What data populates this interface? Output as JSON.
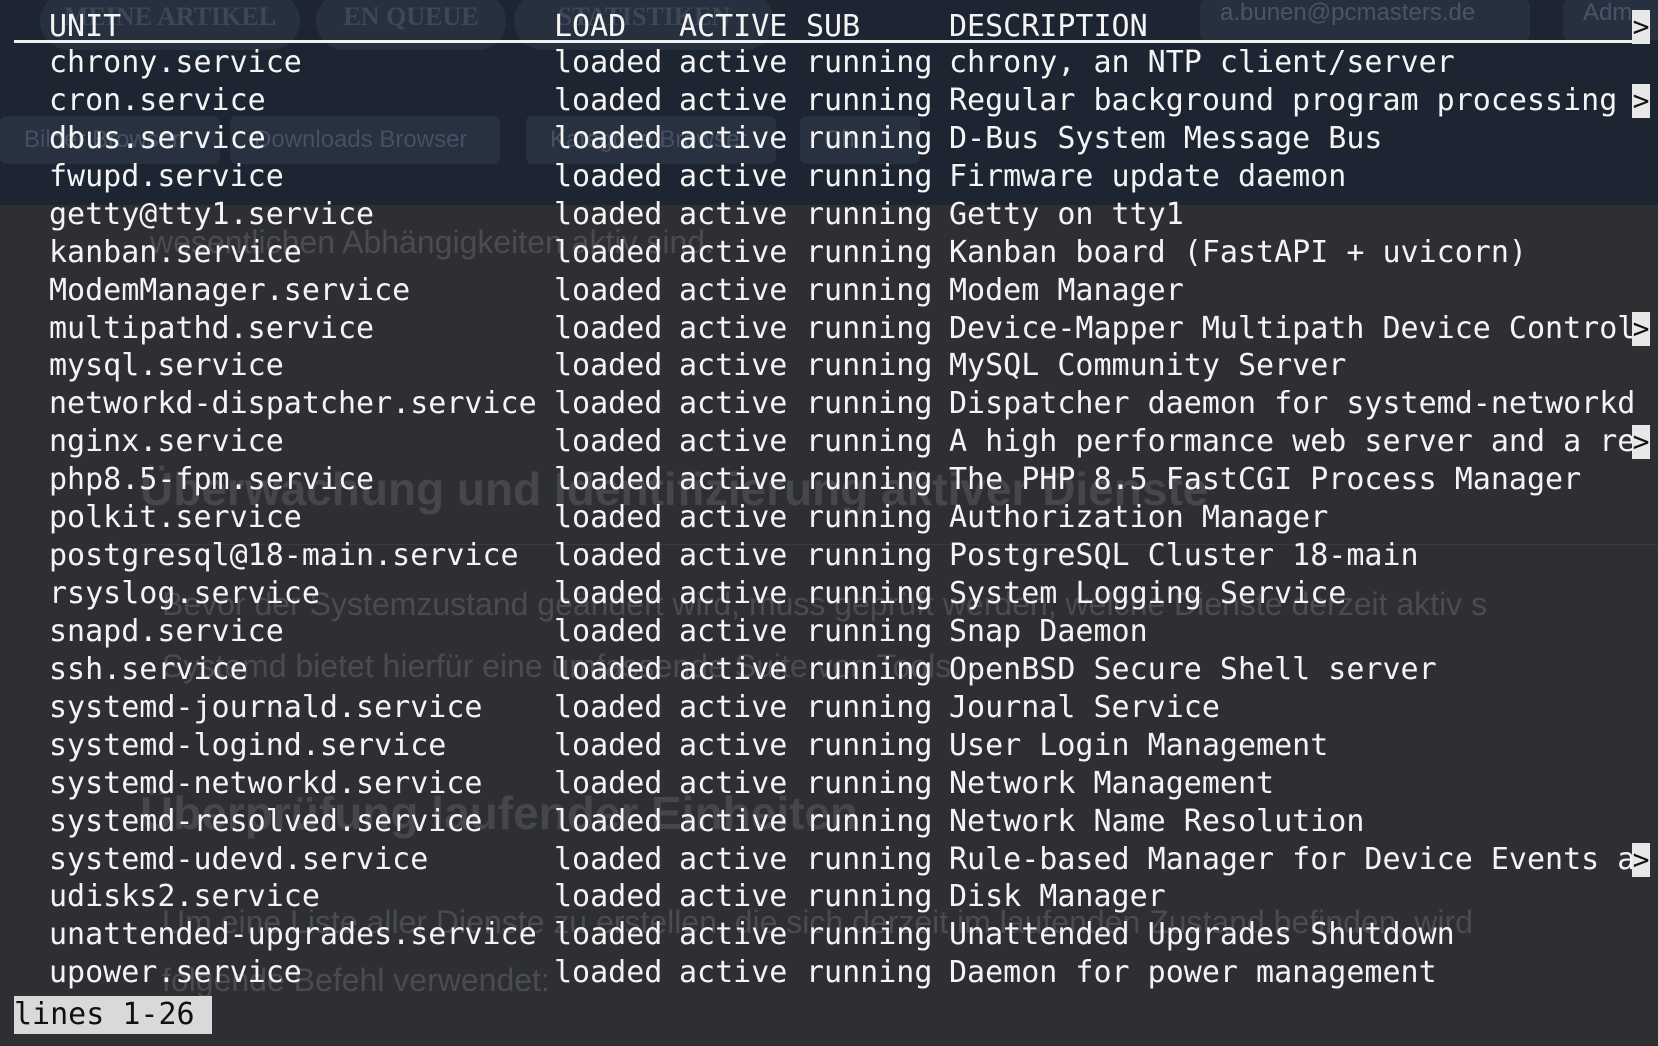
{
  "background_page": {
    "nav": [
      "MEINE ARTIKEL",
      "EN QUEUE",
      "STATISTIKEN"
    ],
    "account_email": "a.bunen@pcmasters.de",
    "admin_label": "Adm",
    "tabs": [
      "Bilder Browser",
      "Downloads Browser",
      "Kategorie Browser",
      "Ch"
    ],
    "lines": [
      "wesentlichen Abhängigkeiten aktiv sind.",
      "Überwachung und Identifizierung aktiver Dienste",
      "Bevor der Systemzustand geändert wird, muss geprüft werden, welche Dienste derzeit aktiv s",
      "Systemd bietet hierfür eine umfassende Suite von Tools.",
      "Überprüfung laufender Einheiten",
      "Um eine Liste aller Dienste zu erstellen, die sich derzeit im laufenden Zustand befinden, wird",
      "folgende Befehl verwendet:"
    ]
  },
  "terminal": {
    "headers": {
      "unit": "UNIT",
      "load": "LOAD",
      "active": "ACTIVE",
      "sub": "SUB",
      "description": "DESCRIPTION"
    },
    "header_truncated": true,
    "truncation_marker": ">",
    "rows": [
      {
        "unit": "chrony.service",
        "load": "loaded",
        "active": "active",
        "sub": "running",
        "description": "chrony, an NTP client/server",
        "truncated": false
      },
      {
        "unit": "cron.service",
        "load": "loaded",
        "active": "active",
        "sub": "running",
        "description": "Regular background program processing",
        "truncated": true
      },
      {
        "unit": "dbus.service",
        "load": "loaded",
        "active": "active",
        "sub": "running",
        "description": "D-Bus System Message Bus",
        "truncated": false
      },
      {
        "unit": "fwupd.service",
        "load": "loaded",
        "active": "active",
        "sub": "running",
        "description": "Firmware update daemon",
        "truncated": false
      },
      {
        "unit": "getty@tty1.service",
        "load": "loaded",
        "active": "active",
        "sub": "running",
        "description": "Getty on tty1",
        "truncated": false
      },
      {
        "unit": "kanban.service",
        "load": "loaded",
        "active": "active",
        "sub": "running",
        "description": "Kanban board (FastAPI + uvicorn)",
        "truncated": false
      },
      {
        "unit": "ModemManager.service",
        "load": "loaded",
        "active": "active",
        "sub": "running",
        "description": "Modem Manager",
        "truncated": false
      },
      {
        "unit": "multipathd.service",
        "load": "loaded",
        "active": "active",
        "sub": "running",
        "description": "Device-Mapper Multipath Device Control",
        "truncated": true
      },
      {
        "unit": "mysql.service",
        "load": "loaded",
        "active": "active",
        "sub": "running",
        "description": "MySQL Community Server",
        "truncated": false
      },
      {
        "unit": "networkd-dispatcher.service",
        "load": "loaded",
        "active": "active",
        "sub": "running",
        "description": "Dispatcher daemon for systemd-networkd",
        "truncated": false
      },
      {
        "unit": "nginx.service",
        "load": "loaded",
        "active": "active",
        "sub": "running",
        "description": "A high performance web server and a re",
        "truncated": true
      },
      {
        "unit": "php8.5-fpm.service",
        "load": "loaded",
        "active": "active",
        "sub": "running",
        "description": "The PHP 8.5 FastCGI Process Manager",
        "truncated": false
      },
      {
        "unit": "polkit.service",
        "load": "loaded",
        "active": "active",
        "sub": "running",
        "description": "Authorization Manager",
        "truncated": false
      },
      {
        "unit": "postgresql@18-main.service",
        "load": "loaded",
        "active": "active",
        "sub": "running",
        "description": "PostgreSQL Cluster 18-main",
        "truncated": false
      },
      {
        "unit": "rsyslog.service",
        "load": "loaded",
        "active": "active",
        "sub": "running",
        "description": "System Logging Service",
        "truncated": false
      },
      {
        "unit": "snapd.service",
        "load": "loaded",
        "active": "active",
        "sub": "running",
        "description": "Snap Daemon",
        "truncated": false
      },
      {
        "unit": "ssh.service",
        "load": "loaded",
        "active": "active",
        "sub": "running",
        "description": "OpenBSD Secure Shell server",
        "truncated": false
      },
      {
        "unit": "systemd-journald.service",
        "load": "loaded",
        "active": "active",
        "sub": "running",
        "description": "Journal Service",
        "truncated": false
      },
      {
        "unit": "systemd-logind.service",
        "load": "loaded",
        "active": "active",
        "sub": "running",
        "description": "User Login Management",
        "truncated": false
      },
      {
        "unit": "systemd-networkd.service",
        "load": "loaded",
        "active": "active",
        "sub": "running",
        "description": "Network Management",
        "truncated": false
      },
      {
        "unit": "systemd-resolved.service",
        "load": "loaded",
        "active": "active",
        "sub": "running",
        "description": "Network Name Resolution",
        "truncated": false
      },
      {
        "unit": "systemd-udevd.service",
        "load": "loaded",
        "active": "active",
        "sub": "running",
        "description": "Rule-based Manager for Device Events a",
        "truncated": true
      },
      {
        "unit": "udisks2.service",
        "load": "loaded",
        "active": "active",
        "sub": "running",
        "description": "Disk Manager",
        "truncated": false
      },
      {
        "unit": "unattended-upgrades.service",
        "load": "loaded",
        "active": "active",
        "sub": "running",
        "description": "Unattended Upgrades Shutdown",
        "truncated": false
      },
      {
        "unit": "upower.service",
        "load": "loaded",
        "active": "active",
        "sub": "running",
        "description": "Daemon for power management",
        "truncated": false
      }
    ],
    "status_line": "lines 1-26"
  },
  "colors": {
    "terminal_bg": "#2d2f33",
    "terminal_fg": "#f4f4f4",
    "status_bg": "#d9d9d9",
    "page_header_bg": "#1d2533"
  }
}
